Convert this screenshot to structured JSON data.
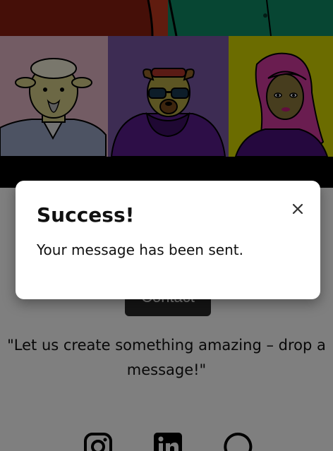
{
  "contact_button": {
    "label": "Contact"
  },
  "quote": {
    "text": "\"Let us create something amazing – drop a message!\""
  },
  "socials": [
    {
      "name": "instagram-icon"
    },
    {
      "name": "linkedin-icon"
    },
    {
      "name": "whatsapp-icon"
    }
  ],
  "modal": {
    "title": "Success!",
    "message": "Your message has been sent.",
    "close_icon": "close-icon"
  },
  "colors": {
    "overlay": "rgba(0,0,0,0.5)",
    "button": "#2a2a2a"
  }
}
